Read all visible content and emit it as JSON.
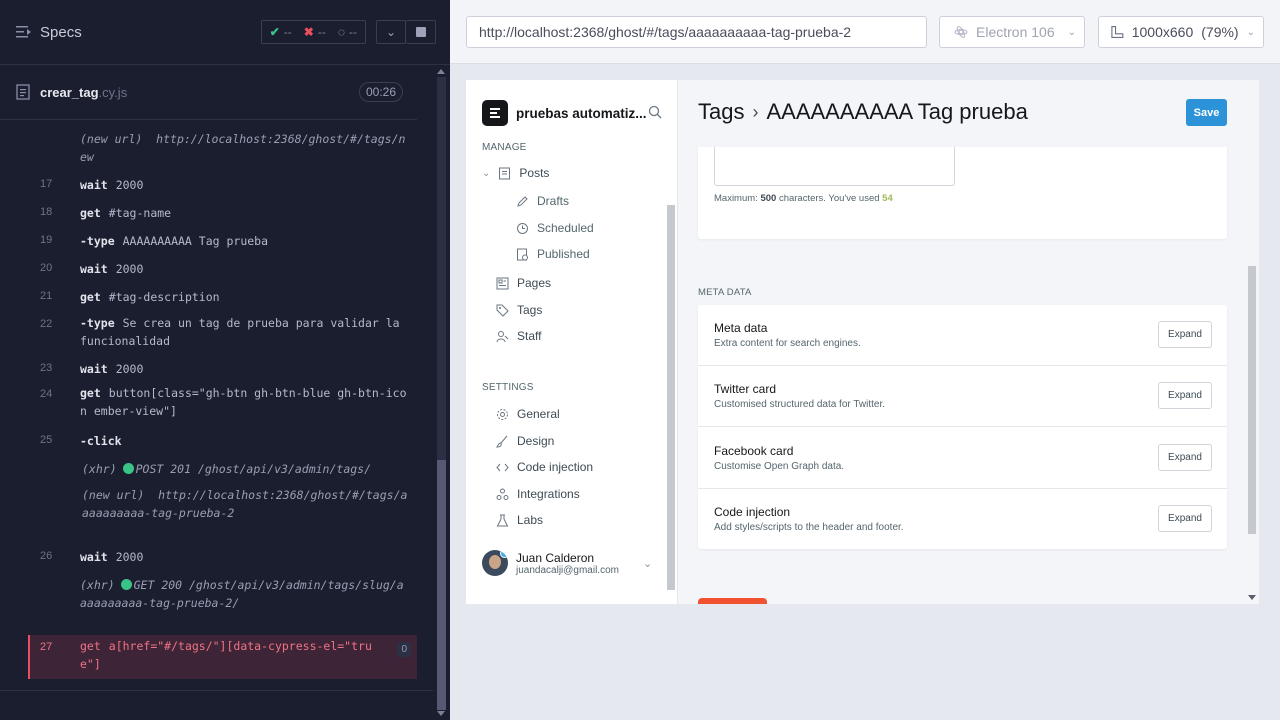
{
  "runner": {
    "specs_label": "Specs",
    "stats": {
      "passed": "--",
      "failed": "--",
      "pending": "--"
    },
    "spec_file": {
      "name": "crear_tag",
      "ext": ".cy.js",
      "time": "00:26"
    },
    "commands": [
      {
        "num": "",
        "label": "(new url)",
        "msg": "http://localhost:2368/ghost/#/tags/new",
        "kind": "event"
      },
      {
        "num": "17",
        "kw": "wait",
        "msg": "2000"
      },
      {
        "num": "18",
        "kw": "get",
        "msg": "#tag-name"
      },
      {
        "num": "19",
        "kw": "-type",
        "msg": "AAAAAAAAAA Tag prueba"
      },
      {
        "num": "20",
        "kw": "wait",
        "msg": "2000"
      },
      {
        "num": "21",
        "kw": "get",
        "msg": "#tag-description"
      },
      {
        "num": "22",
        "kw": "-type",
        "msg": "Se crea un tag de prueba para validar la funcionalidad"
      },
      {
        "num": "23",
        "kw": "wait",
        "msg": "2000"
      },
      {
        "num": "24",
        "kw": "get",
        "msg": "button[class=\"gh-btn gh-btn-blue gh-btn-icon ember-view\"]"
      },
      {
        "num": "25",
        "kw": "-click",
        "msg": ""
      },
      {
        "num": "",
        "label": "(xhr)",
        "msg": "POST 201 /ghost/api/v3/admin/tags/",
        "kind": "xhr"
      },
      {
        "num": "",
        "label": "(new url)",
        "msg": "http://localhost:2368/ghost/#/tags/aaaaaaaaaa-tag-prueba-2",
        "kind": "event"
      },
      {
        "num": "26",
        "kw": "wait",
        "msg": "2000"
      },
      {
        "num": "",
        "label": "(xhr)",
        "msg": "GET 200 /ghost/api/v3/admin/tags/slug/aaaaaaaaaa-tag-prueba-2/",
        "kind": "xhr"
      },
      {
        "num": "27",
        "kw": "get",
        "msg": "a[href=\"#/tags/\"][data-cypress-el=\"true\"]",
        "badge": "0",
        "kind": "active"
      }
    ]
  },
  "browser": {
    "url": "http://localhost:2368/ghost/#/tags/aaaaaaaaaa-tag-prueba-2",
    "browser_name": "Electron 106",
    "viewport": "1000x660",
    "zoom": "(79%)"
  },
  "ghost": {
    "site_title": "pruebas automatiz...",
    "manage_label": "MANAGE",
    "settings_label": "SETTINGS",
    "nav": {
      "posts": "Posts",
      "drafts": "Drafts",
      "scheduled": "Scheduled",
      "published": "Published",
      "pages": "Pages",
      "tags": "Tags",
      "staff": "Staff",
      "general": "General",
      "design": "Design",
      "code_injection": "Code injection",
      "integrations": "Integrations",
      "labs": "Labs"
    },
    "user": {
      "name": "Juan Calderon",
      "email": "juandacalji@gmail.com"
    },
    "breadcrumb": {
      "parent": "Tags",
      "current": "AAAAAAAAAA Tag prueba"
    },
    "save_label": "Save",
    "hint": {
      "prefix": "Maximum:",
      "max": "500",
      "middle": "characters. You've used",
      "used": "54"
    },
    "meta_section_label": "META DATA",
    "meta_rows": [
      {
        "title": "Meta data",
        "desc": "Extra content for search engines.",
        "button": "Expand"
      },
      {
        "title": "Twitter card",
        "desc": "Customised structured data for Twitter.",
        "button": "Expand"
      },
      {
        "title": "Facebook card",
        "desc": "Customise Open Graph data.",
        "button": "Expand"
      },
      {
        "title": "Code injection",
        "desc": "Add styles/scripts to the header and footer.",
        "button": "Expand"
      }
    ]
  },
  "colors": {
    "runner_bg": "#1b1e2e",
    "pass_green": "#3ac386",
    "fail_red": "#e94f5f",
    "ghost_blue": "#2c93d9",
    "ghost_red": "#f05230"
  }
}
